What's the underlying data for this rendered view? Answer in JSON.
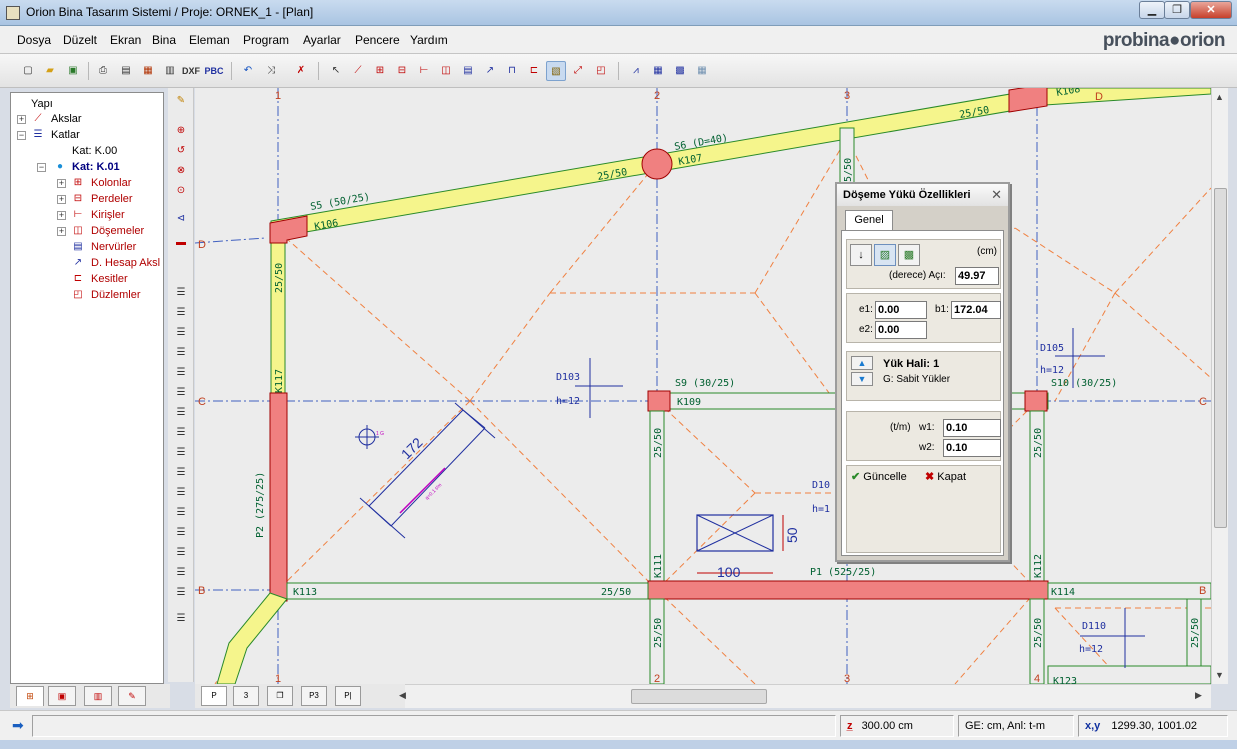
{
  "window": {
    "title": "Orion Bina Tasarım Sistemi / Proje: ORNEK_1 - [Plan]",
    "minimize": "▁",
    "restore": "❐",
    "close": "✕"
  },
  "brand": "probina●orion",
  "menu": [
    "Dosya",
    "Düzelt",
    "Ekran",
    "Bina",
    "Eleman",
    "Program",
    "Ayarlar",
    "Pencere",
    "Yardım"
  ],
  "toolbar_icons": [
    "new-file-icon",
    "open-folder-icon",
    "save-icon",
    "print-icon",
    "print-preview-icon",
    "table-icon",
    "report-icon",
    "dxf-export-icon",
    "pbc-export-icon",
    "undo-icon",
    "redo-icon",
    "delete-icon",
    "select-arrow-icon",
    "axis-icon",
    "column-icon",
    "wall-icon",
    "beam-icon",
    "slab-icon",
    "rib-icon",
    "line-icon",
    "dimension-icon",
    "stair-icon",
    "slab-load-icon",
    "section-icon",
    "plane-icon",
    "3d-view-icon",
    "grid-icon",
    "building-icon",
    "layout-icon"
  ],
  "toolbar_labels": {
    "dxf": "DXF",
    "pbc": "PBC"
  },
  "tree": {
    "root": "Yapı",
    "akslar": "Akslar",
    "katlar": "Katlar",
    "kat_k00": "Kat: K.00",
    "kat_k01": "Kat: K.01",
    "children": [
      "Kolonlar",
      "Perdeler",
      "Kirişler",
      "Döşemeler",
      "Nervürler",
      "D. Hesap Aksl",
      "Kesitler",
      "Düzlemler"
    ]
  },
  "left_tabs": [
    "structure-tab",
    "render-tab",
    "reports-tab",
    "tools-tab"
  ],
  "view_tabs": [
    "P",
    "3",
    "",
    "P3",
    "P|"
  ],
  "dialog": {
    "title": "Döşeme Yükü Özellikleri",
    "close": "✕",
    "tab": "Genel",
    "unit_cm": "(cm)",
    "angle_label": "(derece) Açı:",
    "angle_value": "49.97",
    "e1_label": "e1:",
    "e1_value": "0.00",
    "b1_label": "b1:",
    "b1_value": "172.04",
    "e2_label": "e2:",
    "e2_value": "0.00",
    "load_case": "Yük Hali: 1",
    "load_case_name": "G: Sabit Yükler",
    "unit_tm": "(t/m)",
    "w1_label": "w1:",
    "w1_value": "0.10",
    "w2_label": "w2:",
    "w2_value": "0.10",
    "update_btn": "Güncelle",
    "close_btn": "Kapat"
  },
  "plan": {
    "axes_top": [
      "1",
      "2",
      "3"
    ],
    "axes_bottom": [
      "1",
      "2",
      "3",
      "4"
    ],
    "axes_left": [
      "D",
      "C",
      "B"
    ],
    "axes_right": [
      "D",
      "C",
      "B"
    ],
    "beams": [
      "K106",
      "K107",
      "K108",
      "K109",
      "K113",
      "K114",
      "K117",
      "K111",
      "K112",
      "K123"
    ],
    "columns": [
      "S5 (50/25)",
      "S6 (D=40)",
      "S9 (30/25)",
      "S10 (30/25)"
    ],
    "walls": [
      "P2 (275/25)",
      "P1 (525/25)"
    ],
    "slabs": [
      {
        "id": "D103",
        "h": "h=12"
      },
      {
        "id": "D105",
        "h": "h=12"
      },
      {
        "id": "D110",
        "h": "h=12"
      },
      {
        "id": "D10",
        "h": "h=1"
      }
    ],
    "section_labels": [
      "25/50",
      "25/50",
      "25/50",
      "25/50",
      "25/50",
      "25/50",
      "25/50",
      "25/50",
      "25/50"
    ],
    "dim_172": "172",
    "dim_100": "100",
    "dim_50": "50",
    "load_small_label": "q=0.1 t/m",
    "marker_label": "1 G"
  },
  "status": {
    "z_label": "300.00 cm",
    "units": "GE: cm,  Anl: t-m",
    "xy_label": "x,y",
    "xy_value": "1299.30, 1001.02"
  },
  "colors": {
    "beam_fill": "#f5f58c",
    "column_fill": "#f08080",
    "plan_bg": "#ececec",
    "dash_orange": "#f08040",
    "axis_blue": "#4060c0",
    "text_green": "#006030"
  }
}
